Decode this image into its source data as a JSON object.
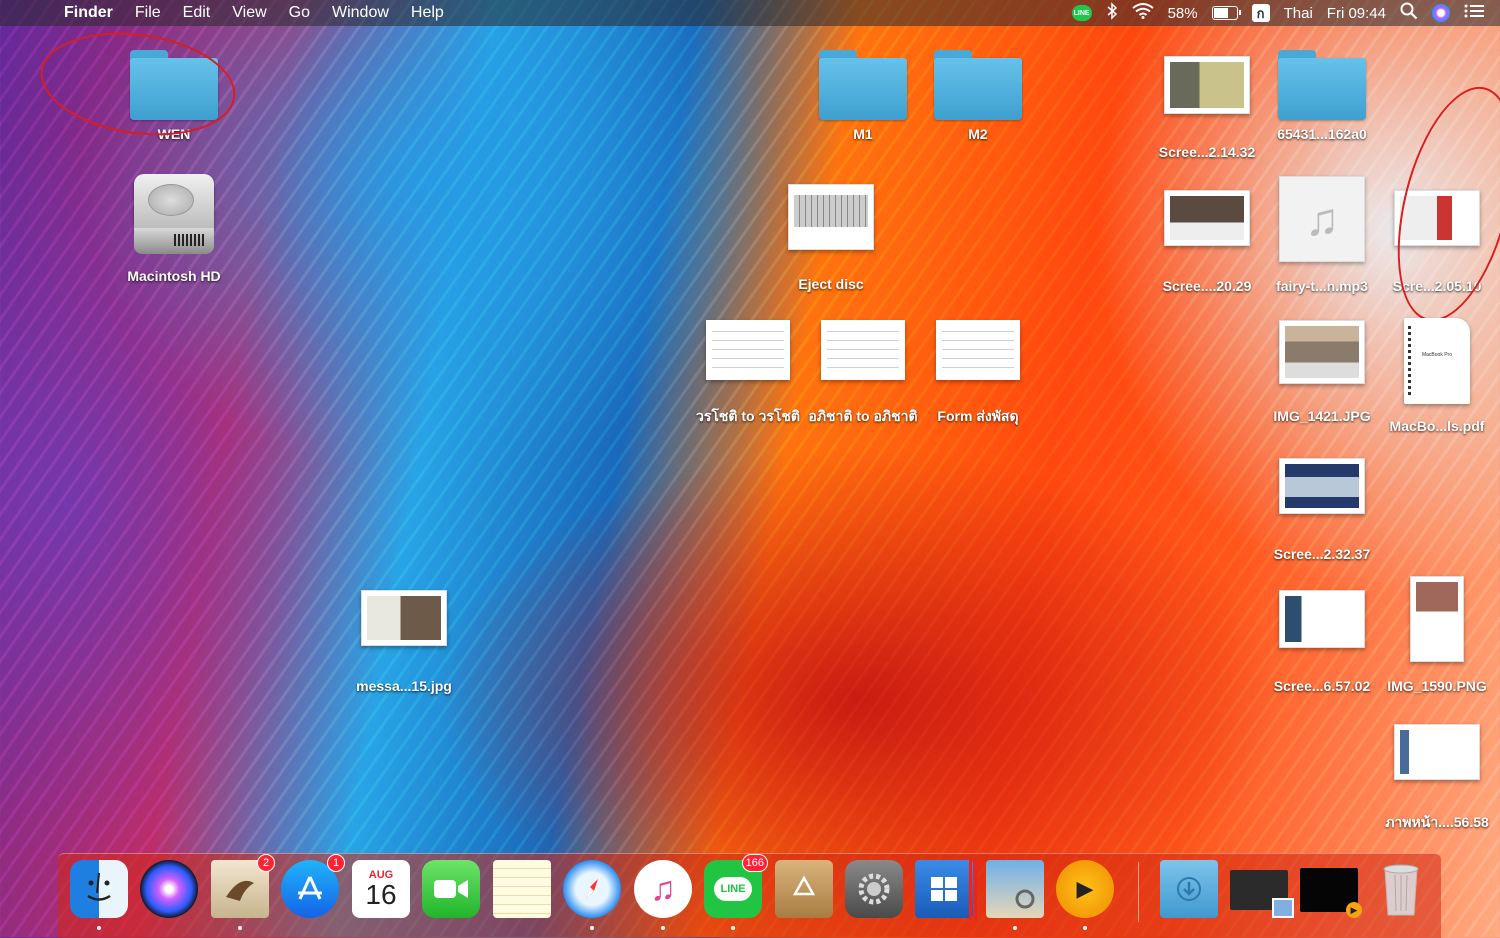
{
  "menubar": {
    "apple_glyph": "",
    "app_name": "Finder",
    "menus": [
      "File",
      "Edit",
      "View",
      "Go",
      "Window",
      "Help"
    ],
    "status": {
      "line_icon": "LINE",
      "battery_percent": "58%",
      "battery_level": 0.58,
      "input_source_glyph": "ก",
      "input_source": "Thai",
      "clock": "Fri 09:44"
    }
  },
  "desktop": {
    "left": {
      "wen": "WEN",
      "macintosh_hd": "Macintosh HD",
      "message_image": "messa...15.jpg"
    },
    "middle": {
      "m1": "M1",
      "m2": "M2",
      "eject_disc": "Eject disc",
      "doc1": "วรโชติ to วรโชติ",
      "doc2": "อภิชาติ to อภิชาติ",
      "doc3": "Form ส่งพัสดุ"
    },
    "right": {
      "scree_21432": "Scree...2.14.32",
      "folder_65431": "65431...162a0",
      "scree_2029": "Scree....20.29",
      "fairy_mp3": "fairy-t...n.mp3",
      "scree_20510": "Scre...2.05.10",
      "img_1421": "IMG_1421.JPG",
      "macbook_pdf": "MacBo...ls.pdf",
      "pdf_cover_text": "MacBook Pro",
      "scree_23237": "Scree...2.32.37",
      "scree_65702": "Scree...6.57.02",
      "img_1590": "IMG_1590.PNG",
      "thai_img": "ภาพหน้า....56.58"
    }
  },
  "dock": {
    "finder": "finder",
    "siri": "siri",
    "mail_badge": "2",
    "appstore_badge": "1",
    "calendar_month": "AUG",
    "calendar_day": "16",
    "line_label": "LINE",
    "line_badge": "166",
    "play_glyph": "▶"
  }
}
